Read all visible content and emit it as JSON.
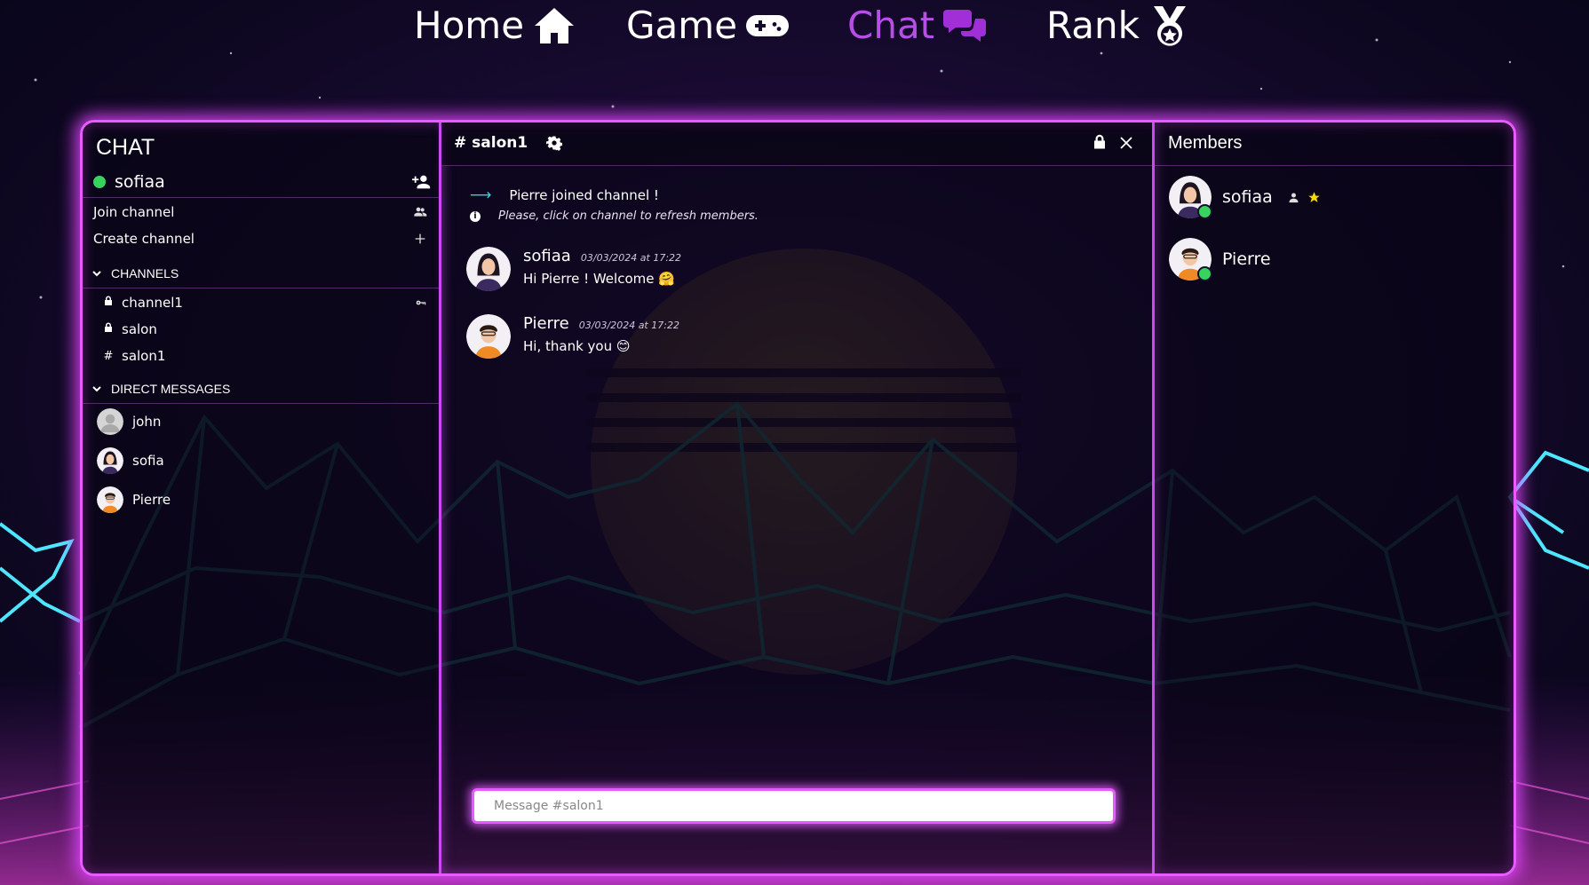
{
  "nav": {
    "items": [
      {
        "label": "Home",
        "icon": "home-icon"
      },
      {
        "label": "Game",
        "icon": "gamepad-icon"
      },
      {
        "label": "Chat",
        "icon": "chat-bubbles-icon"
      },
      {
        "label": "Rank",
        "icon": "medal-icon"
      }
    ],
    "active_color": "#b64fe6"
  },
  "sidebar": {
    "title": "CHAT",
    "user": {
      "name": "sofiaa",
      "status_color": "#36d35e"
    },
    "links": [
      {
        "label": "Join channel",
        "icon": "users-icon"
      },
      {
        "label": "Create channel",
        "icon": "plus-icon"
      }
    ],
    "channels_header": "CHANNELS",
    "channels": [
      {
        "name": "channel1",
        "prefix_icon": "lock-icon",
        "has_key": true
      },
      {
        "name": "salon",
        "prefix_icon": "lock-icon",
        "has_key": false
      },
      {
        "name": "salon1",
        "prefix": "#",
        "has_key": false
      }
    ],
    "dm_header": "DIRECT MESSAGES",
    "dms": [
      {
        "name": "john",
        "avatar": "default-avatar"
      },
      {
        "name": "sofia",
        "avatar": "woman-avatar"
      },
      {
        "name": "Pierre",
        "avatar": "man-avatar"
      }
    ]
  },
  "channel": {
    "name": "# salon1",
    "system": [
      {
        "text": "Pierre joined channel !",
        "icon": "arrow-right-icon"
      },
      {
        "text": "Please, click on channel to refresh members.",
        "icon": "info-icon"
      }
    ],
    "messages": [
      {
        "author": "sofiaa",
        "time": "03/03/2024 at 17:22",
        "text": "Hi Pierre ! Welcome 🤗",
        "avatar": "woman-avatar"
      },
      {
        "author": "Pierre",
        "time": "03/03/2024 at 17:22",
        "text": "Hi, thank you 😊",
        "avatar": "man-avatar"
      }
    ],
    "input_placeholder": "Message #salon1"
  },
  "members": {
    "title": "Members",
    "list": [
      {
        "name": "sofiaa",
        "avatar": "woman-avatar",
        "online": true,
        "badges": [
          "person-icon",
          "star-icon"
        ]
      },
      {
        "name": "Pierre",
        "avatar": "man-avatar",
        "online": true,
        "badges": []
      }
    ]
  },
  "theme": {
    "neon": "#e85cff",
    "online": "#36d35e",
    "star": "#f5d90a"
  }
}
